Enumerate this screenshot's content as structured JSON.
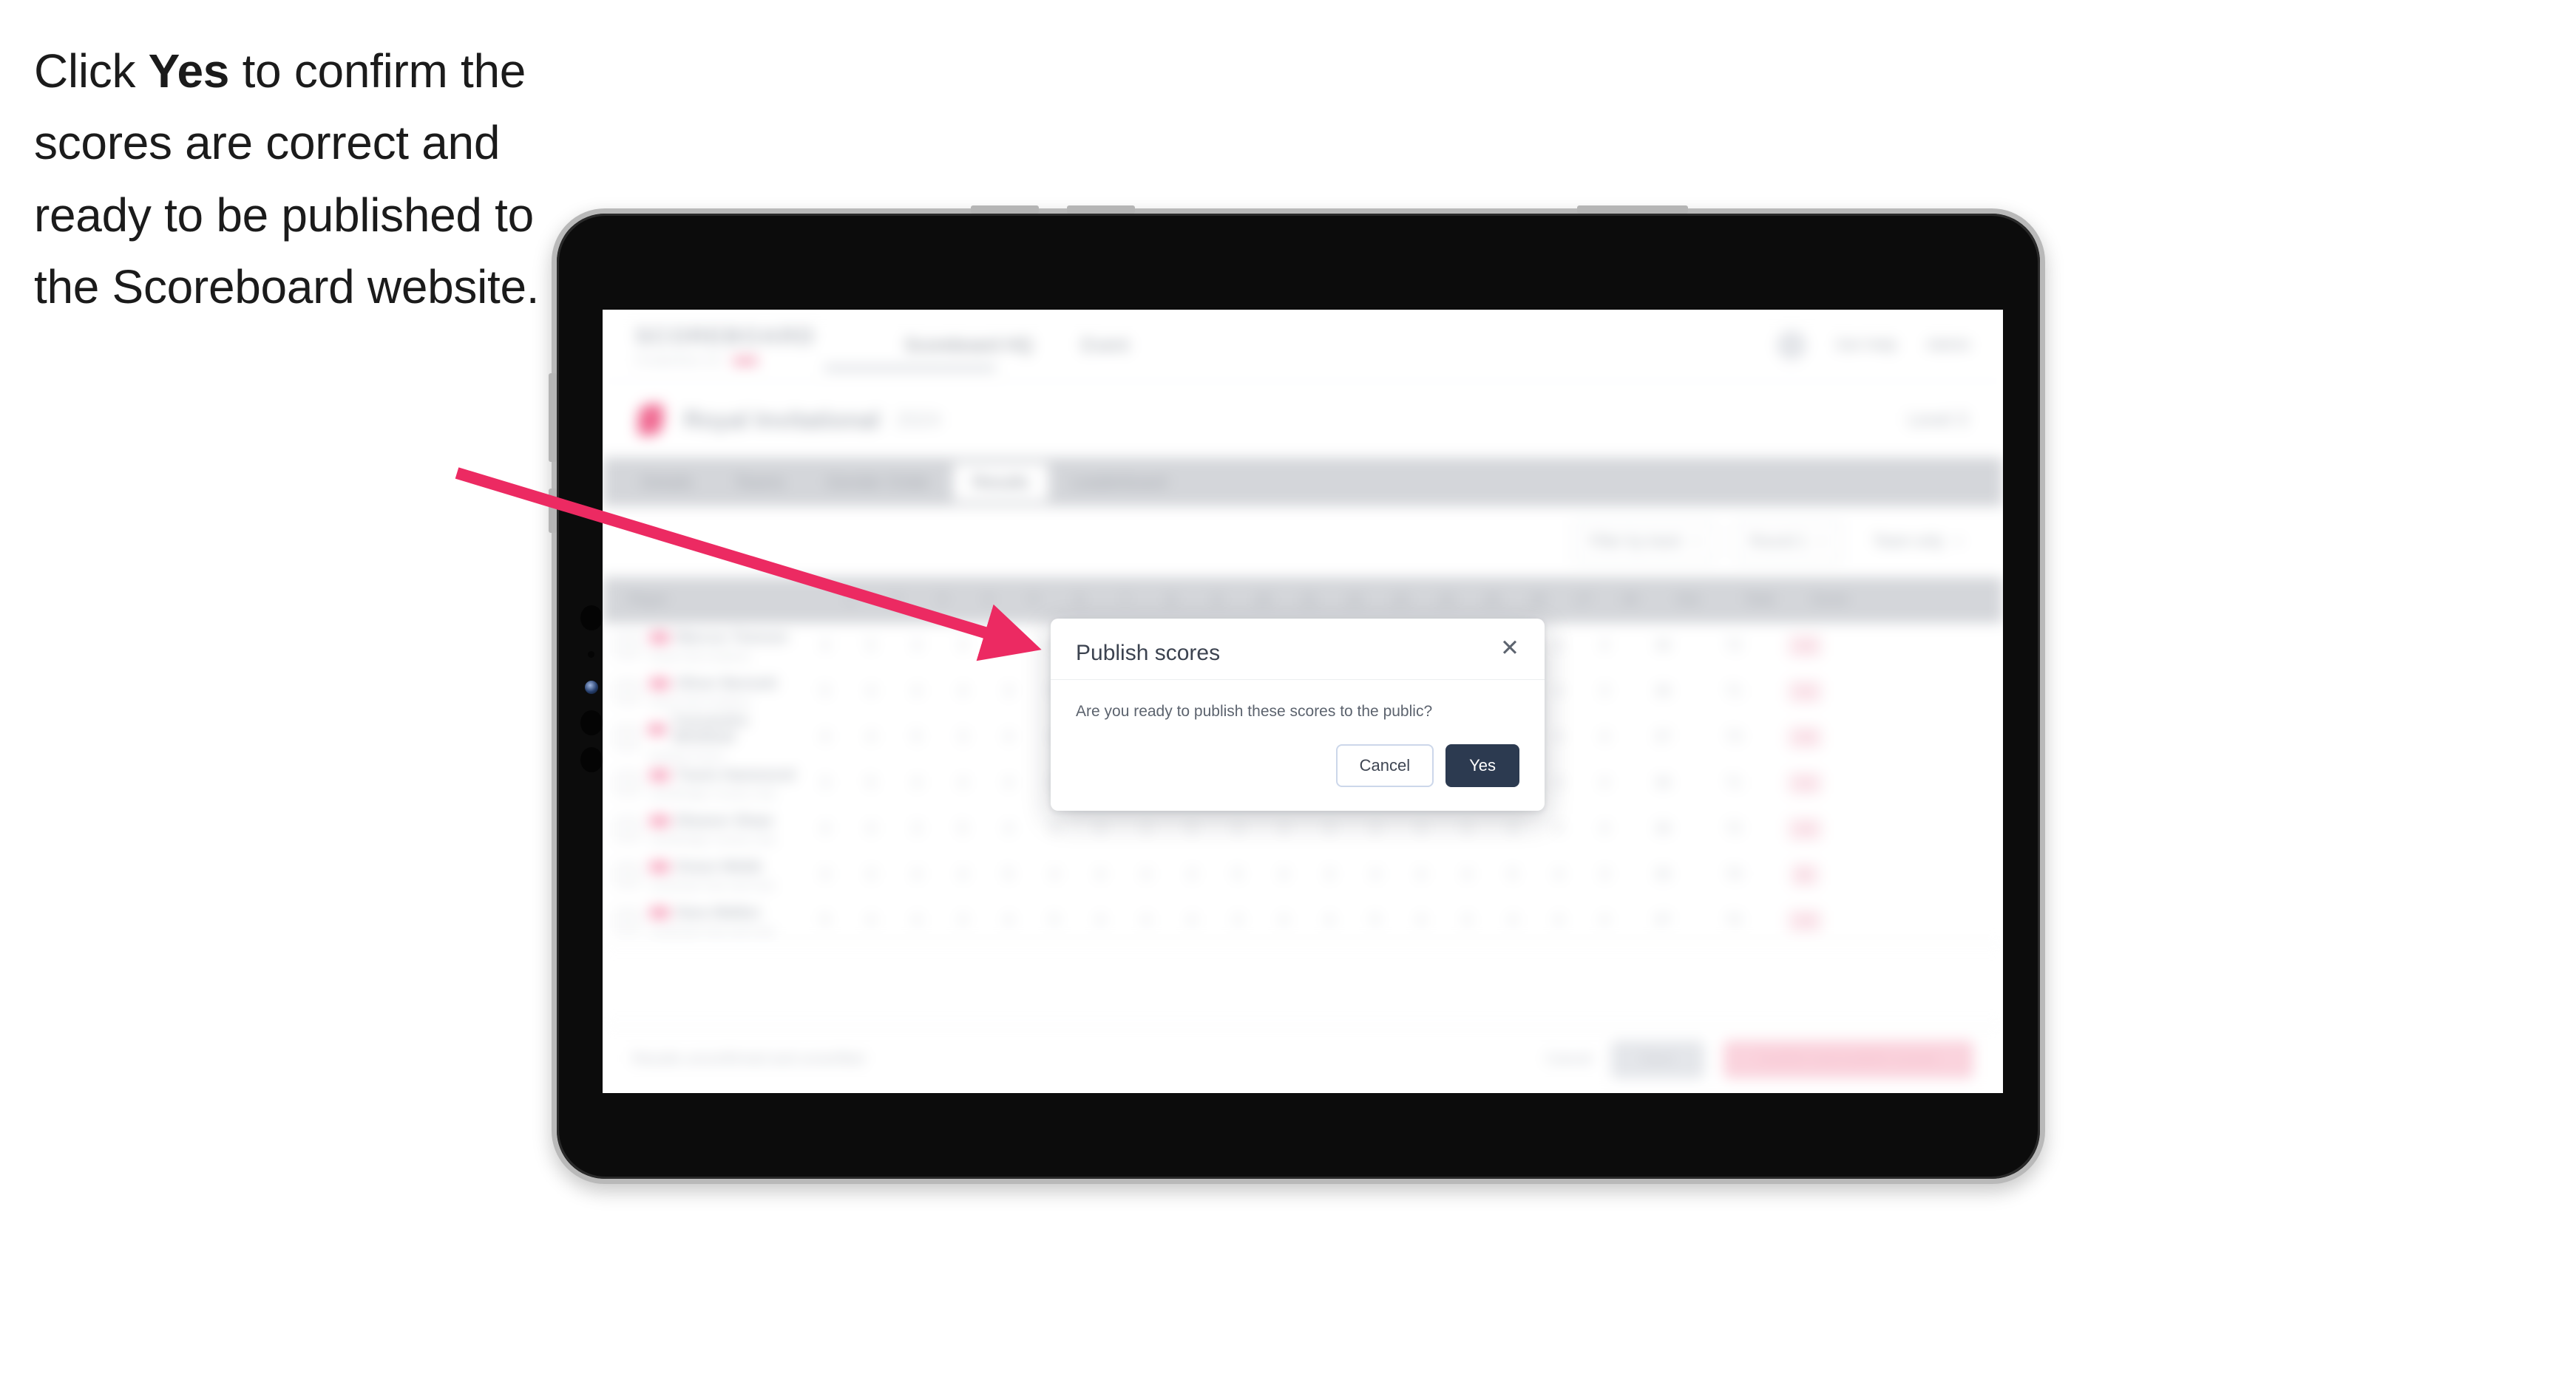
{
  "instruction": {
    "before": "Click ",
    "emphasis": "Yes",
    "after": " to confirm the scores are correct and ready to be published to the Scoreboard website."
  },
  "colors": {
    "accent_pink": "#ec2a62",
    "modal_primary": "#2c3a50",
    "device_body": "#0b0b0b",
    "device_bezel": "#b9b9b9"
  },
  "app": {
    "brand": {
      "word": "SCOREBOARD",
      "sub": "POWERED BY",
      "dot": ""
    },
    "nav": [
      {
        "label": "Scoreboard HQ"
      },
      {
        "label": "Event"
      }
    ],
    "nav_right": [
      {
        "label": "Get Help"
      },
      {
        "label": "Admin"
      }
    ],
    "title_bar": {
      "competition": "Royal Invitational",
      "year": "2024",
      "right": "Level 3"
    },
    "tabs": [
      {
        "label": "Details"
      },
      {
        "label": "Teams"
      },
      {
        "label": "Gender Order"
      },
      {
        "label": "Results"
      },
      {
        "label": "Leaderboard"
      }
    ],
    "selected_tab": "Results",
    "filters": [
      {
        "label": "Filter by team",
        "icon": "chevron-down-icon"
      },
      {
        "label": "Round 1",
        "icon": "chevron-down-icon"
      },
      {
        "label": "Team only",
        "icon": "chevron-down-icon"
      }
    ],
    "table": {
      "headers": [
        "Player",
        "1",
        "2",
        "3",
        "4",
        "5",
        "6",
        "7",
        "8",
        "9",
        "10",
        "11",
        "12",
        "13",
        "14",
        "15",
        "16",
        "17",
        "18",
        "Out",
        "Total",
        "Score"
      ],
      "rows": [
        {
          "player": "Marcus Tomson",
          "club": "Royal Oak Academy",
          "scores": [
            "4",
            "5",
            "4",
            "3",
            "4",
            "5",
            "4",
            "4",
            "3",
            "4",
            "5",
            "3",
            "4",
            "4",
            "5",
            "3",
            "4",
            "4"
          ],
          "out": "36",
          "total": "72",
          "score": "+2"
        },
        {
          "player": "Oliver Bennett",
          "club": "Royal Oak Academy",
          "scores": [
            "5",
            "4",
            "4",
            "4",
            "3",
            "5",
            "4",
            "3",
            "4",
            "4",
            "4",
            "4",
            "5",
            "3",
            "4",
            "4",
            "4",
            "3"
          ],
          "out": "36",
          "total": "71",
          "score": "+1"
        },
        {
          "player": "Cassandra Whitfield",
          "club": "Hartland Green",
          "scores": [
            "4",
            "4",
            "5",
            "3",
            "4",
            "4",
            "5",
            "4",
            "4",
            "3",
            "4",
            "5",
            "4",
            "4",
            "3",
            "5",
            "4",
            "4"
          ],
          "out": "37",
          "total": "73",
          "score": "+3"
        },
        {
          "player": "Travis Hammond",
          "club": "Northbridge Country Club",
          "scores": [
            "3",
            "5",
            "4",
            "4",
            "4",
            "3",
            "5",
            "4",
            "4",
            "4",
            "3",
            "4",
            "4",
            "5",
            "4",
            "4",
            "3",
            "4"
          ],
          "out": "36",
          "total": "71",
          "score": "+1"
        },
        {
          "player": "Eleanor Shaw",
          "club": "Northbridge Country Club",
          "scores": [
            "4",
            "4",
            "3",
            "5",
            "4",
            "4",
            "4",
            "3",
            "5",
            "4",
            "4",
            "4",
            "3",
            "4",
            "5",
            "4",
            "4",
            "4"
          ],
          "out": "36",
          "total": "72",
          "score": "+2"
        },
        {
          "player": "Grace Webb",
          "club": "Southvale Park Golf Club",
          "scores": [
            "4",
            "3",
            "4",
            "4",
            "5",
            "4",
            "4",
            "4",
            "3",
            "5",
            "4",
            "3",
            "4",
            "4",
            "4",
            "5",
            "4",
            "3"
          ],
          "out": "35",
          "total": "70",
          "score": "E"
        },
        {
          "player": "Dara Walker",
          "club": "Southvale Park Golf Club",
          "scores": [
            "5",
            "4",
            "4",
            "3",
            "4",
            "5",
            "4",
            "4",
            "4",
            "3",
            "4",
            "4",
            "5",
            "4",
            "3",
            "4",
            "4",
            "4"
          ],
          "out": "37",
          "total": "72",
          "score": "+2"
        }
      ]
    },
    "footer": {
      "status": "Results unconfirmed and unverified",
      "link": "Cancel",
      "secondary_button": "Save",
      "primary_button": "Confirm and publish scores"
    }
  },
  "modal": {
    "title": "Publish scores",
    "close_icon": "close-icon",
    "message": "Are you ready to publish these scores to the public?",
    "cancel_label": "Cancel",
    "yes_label": "Yes"
  }
}
